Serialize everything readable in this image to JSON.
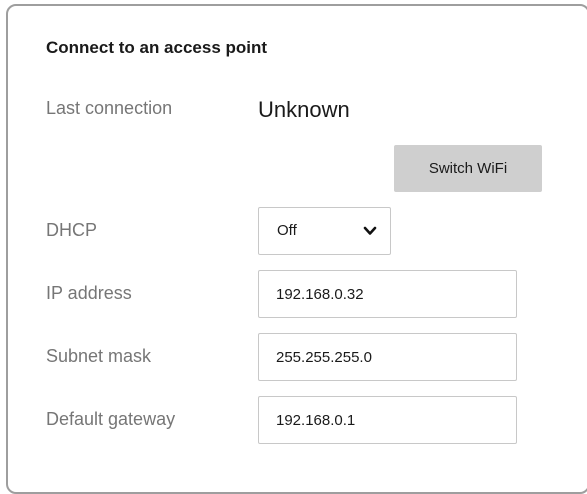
{
  "dialog": {
    "title": "Connect to an access point"
  },
  "last_connection": {
    "label": "Last connection",
    "value": "Unknown"
  },
  "switch_wifi_button": {
    "label": "Switch WiFi"
  },
  "dhcp": {
    "label": "DHCP",
    "selected": "Off"
  },
  "ip_address": {
    "label": "IP address",
    "value": "192.168.0.32"
  },
  "subnet_mask": {
    "label": "Subnet mask",
    "value": "255.255.255.0"
  },
  "default_gateway": {
    "label": "Default gateway",
    "value": "192.168.0.1"
  },
  "icons": {
    "dhcp_dropdown": "chevron-down-icon"
  }
}
